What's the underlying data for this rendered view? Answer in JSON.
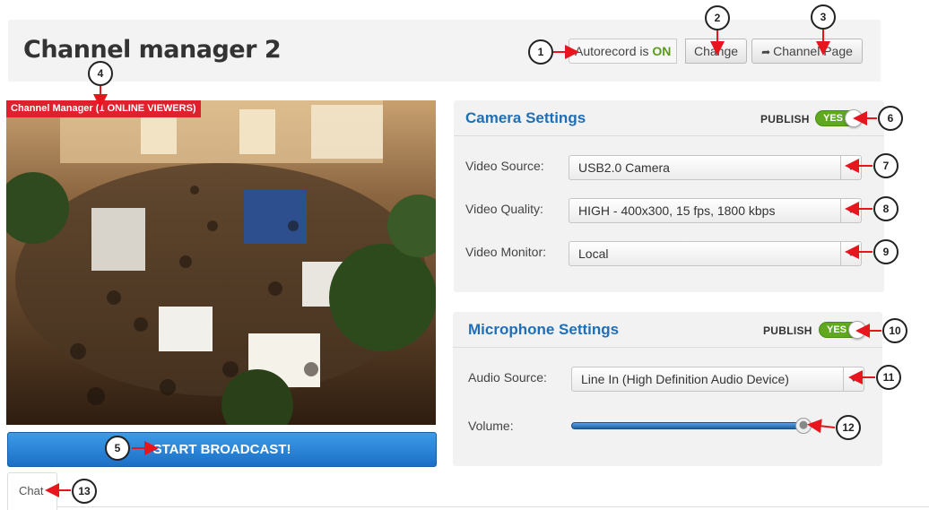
{
  "header": {
    "title": "Channel manager 2",
    "autorecord_label": "Autorecord is",
    "autorecord_status": "ON",
    "change_button": "Change",
    "channel_page_button": "Channel Page",
    "channel_page_icon": "share-arrow-icon"
  },
  "video": {
    "overlay_label": "Channel Manager (1 ONLINE VIEWERS)"
  },
  "start_button": "START BROADCAST!",
  "tabs": [
    {
      "label": "Chat"
    }
  ],
  "camera": {
    "title": "Camera Settings",
    "publish_label": "PUBLISH",
    "publish_value": "YES",
    "fields": [
      {
        "label": "Video Source:",
        "value": "USB2.0 Camera"
      },
      {
        "label": "Video Quality:",
        "value": "HIGH - 400x300, 15 fps, 1800 kbps"
      },
      {
        "label": "Video Monitor:",
        "value": "Local"
      }
    ]
  },
  "microphone": {
    "title": "Microphone Settings",
    "publish_label": "PUBLISH",
    "publish_value": "YES",
    "audio_source_label": "Audio Source:",
    "audio_source_value": "Line In (High Definition Audio Device)",
    "volume_label": "Volume:",
    "volume_level": 0.98
  },
  "callouts": [
    "1",
    "2",
    "3",
    "4",
    "5",
    "6",
    "7",
    "8",
    "9",
    "10",
    "11",
    "12",
    "13"
  ],
  "colors": {
    "accent_blue": "#1f6fb8",
    "publish_green": "#5fa81f",
    "on_green": "#5a9c19",
    "label_red": "#e0202c",
    "arrow_red": "#e8141e"
  }
}
